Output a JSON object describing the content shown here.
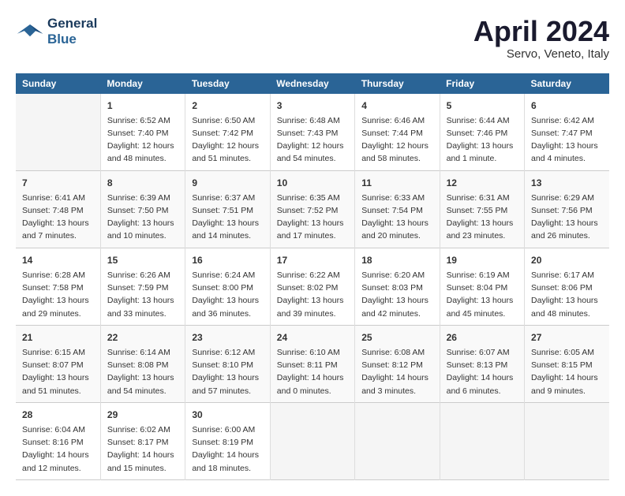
{
  "header": {
    "logo_line1": "General",
    "logo_line2": "Blue",
    "month": "April 2024",
    "location": "Servo, Veneto, Italy"
  },
  "columns": [
    "Sunday",
    "Monday",
    "Tuesday",
    "Wednesday",
    "Thursday",
    "Friday",
    "Saturday"
  ],
  "weeks": [
    [
      {
        "day": "",
        "content": ""
      },
      {
        "day": "1",
        "content": "Sunrise: 6:52 AM\nSunset: 7:40 PM\nDaylight: 12 hours\nand 48 minutes."
      },
      {
        "day": "2",
        "content": "Sunrise: 6:50 AM\nSunset: 7:42 PM\nDaylight: 12 hours\nand 51 minutes."
      },
      {
        "day": "3",
        "content": "Sunrise: 6:48 AM\nSunset: 7:43 PM\nDaylight: 12 hours\nand 54 minutes."
      },
      {
        "day": "4",
        "content": "Sunrise: 6:46 AM\nSunset: 7:44 PM\nDaylight: 12 hours\nand 58 minutes."
      },
      {
        "day": "5",
        "content": "Sunrise: 6:44 AM\nSunset: 7:46 PM\nDaylight: 13 hours\nand 1 minute."
      },
      {
        "day": "6",
        "content": "Sunrise: 6:42 AM\nSunset: 7:47 PM\nDaylight: 13 hours\nand 4 minutes."
      }
    ],
    [
      {
        "day": "7",
        "content": "Sunrise: 6:41 AM\nSunset: 7:48 PM\nDaylight: 13 hours\nand 7 minutes."
      },
      {
        "day": "8",
        "content": "Sunrise: 6:39 AM\nSunset: 7:50 PM\nDaylight: 13 hours\nand 10 minutes."
      },
      {
        "day": "9",
        "content": "Sunrise: 6:37 AM\nSunset: 7:51 PM\nDaylight: 13 hours\nand 14 minutes."
      },
      {
        "day": "10",
        "content": "Sunrise: 6:35 AM\nSunset: 7:52 PM\nDaylight: 13 hours\nand 17 minutes."
      },
      {
        "day": "11",
        "content": "Sunrise: 6:33 AM\nSunset: 7:54 PM\nDaylight: 13 hours\nand 20 minutes."
      },
      {
        "day": "12",
        "content": "Sunrise: 6:31 AM\nSunset: 7:55 PM\nDaylight: 13 hours\nand 23 minutes."
      },
      {
        "day": "13",
        "content": "Sunrise: 6:29 AM\nSunset: 7:56 PM\nDaylight: 13 hours\nand 26 minutes."
      }
    ],
    [
      {
        "day": "14",
        "content": "Sunrise: 6:28 AM\nSunset: 7:58 PM\nDaylight: 13 hours\nand 29 minutes."
      },
      {
        "day": "15",
        "content": "Sunrise: 6:26 AM\nSunset: 7:59 PM\nDaylight: 13 hours\nand 33 minutes."
      },
      {
        "day": "16",
        "content": "Sunrise: 6:24 AM\nSunset: 8:00 PM\nDaylight: 13 hours\nand 36 minutes."
      },
      {
        "day": "17",
        "content": "Sunrise: 6:22 AM\nSunset: 8:02 PM\nDaylight: 13 hours\nand 39 minutes."
      },
      {
        "day": "18",
        "content": "Sunrise: 6:20 AM\nSunset: 8:03 PM\nDaylight: 13 hours\nand 42 minutes."
      },
      {
        "day": "19",
        "content": "Sunrise: 6:19 AM\nSunset: 8:04 PM\nDaylight: 13 hours\nand 45 minutes."
      },
      {
        "day": "20",
        "content": "Sunrise: 6:17 AM\nSunset: 8:06 PM\nDaylight: 13 hours\nand 48 minutes."
      }
    ],
    [
      {
        "day": "21",
        "content": "Sunrise: 6:15 AM\nSunset: 8:07 PM\nDaylight: 13 hours\nand 51 minutes."
      },
      {
        "day": "22",
        "content": "Sunrise: 6:14 AM\nSunset: 8:08 PM\nDaylight: 13 hours\nand 54 minutes."
      },
      {
        "day": "23",
        "content": "Sunrise: 6:12 AM\nSunset: 8:10 PM\nDaylight: 13 hours\nand 57 minutes."
      },
      {
        "day": "24",
        "content": "Sunrise: 6:10 AM\nSunset: 8:11 PM\nDaylight: 14 hours\nand 0 minutes."
      },
      {
        "day": "25",
        "content": "Sunrise: 6:08 AM\nSunset: 8:12 PM\nDaylight: 14 hours\nand 3 minutes."
      },
      {
        "day": "26",
        "content": "Sunrise: 6:07 AM\nSunset: 8:13 PM\nDaylight: 14 hours\nand 6 minutes."
      },
      {
        "day": "27",
        "content": "Sunrise: 6:05 AM\nSunset: 8:15 PM\nDaylight: 14 hours\nand 9 minutes."
      }
    ],
    [
      {
        "day": "28",
        "content": "Sunrise: 6:04 AM\nSunset: 8:16 PM\nDaylight: 14 hours\nand 12 minutes."
      },
      {
        "day": "29",
        "content": "Sunrise: 6:02 AM\nSunset: 8:17 PM\nDaylight: 14 hours\nand 15 minutes."
      },
      {
        "day": "30",
        "content": "Sunrise: 6:00 AM\nSunset: 8:19 PM\nDaylight: 14 hours\nand 18 minutes."
      },
      {
        "day": "",
        "content": ""
      },
      {
        "day": "",
        "content": ""
      },
      {
        "day": "",
        "content": ""
      },
      {
        "day": "",
        "content": ""
      }
    ]
  ]
}
